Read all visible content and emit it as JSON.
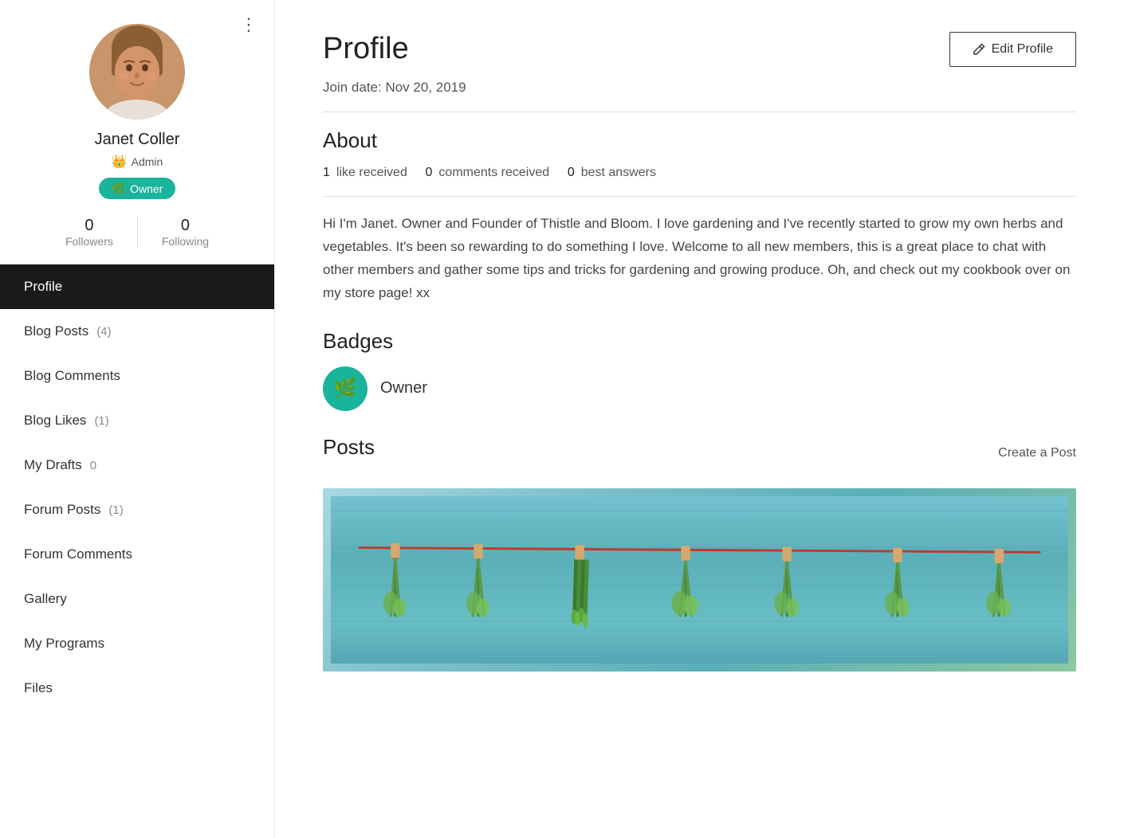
{
  "sidebar": {
    "more_menu_label": "⋮",
    "user": {
      "name": "Janet Coller",
      "role": "Admin",
      "badge": "Owner",
      "followers": 0,
      "following": 0,
      "followers_label": "Followers",
      "following_label": "Following"
    },
    "nav_items": [
      {
        "id": "profile",
        "label": "Profile",
        "badge": null,
        "active": true
      },
      {
        "id": "blog-posts",
        "label": "Blog Posts",
        "badge": "(4)",
        "active": false
      },
      {
        "id": "blog-comments",
        "label": "Blog Comments",
        "badge": null,
        "active": false
      },
      {
        "id": "blog-likes",
        "label": "Blog Likes",
        "badge": "(1)",
        "active": false
      },
      {
        "id": "my-drafts",
        "label": "My Drafts",
        "badge": "0",
        "active": false
      },
      {
        "id": "forum-posts",
        "label": "Forum Posts",
        "badge": "(1)",
        "active": false
      },
      {
        "id": "forum-comments",
        "label": "Forum Comments",
        "badge": null,
        "active": false
      },
      {
        "id": "gallery",
        "label": "Gallery",
        "badge": null,
        "active": false
      },
      {
        "id": "my-programs",
        "label": "My Programs",
        "badge": null,
        "active": false
      },
      {
        "id": "files",
        "label": "Files",
        "badge": null,
        "active": false
      }
    ]
  },
  "main": {
    "page_title": "Profile",
    "edit_profile_label": "Edit Profile",
    "join_date": "Join date: Nov 20, 2019",
    "about_section": {
      "title": "About",
      "likes_received_count": "1",
      "likes_received_label": "like received",
      "comments_received_count": "0",
      "comments_received_label": "comments received",
      "best_answers_count": "0",
      "best_answers_label": "best answers"
    },
    "bio": "Hi I'm Janet. Owner and Founder of Thistle and Bloom. I love gardening and I've recently started to grow my own herbs and vegetables. It's been so rewarding to do something I love. Welcome to all new members, this is a great place to chat with other members and gather some tips and tricks for gardening and growing produce. Oh, and check out my cookbook over on my store page! xx",
    "badges_section": {
      "title": "Badges",
      "badges": [
        {
          "name": "Owner"
        }
      ]
    },
    "posts_section": {
      "title": "Posts",
      "create_post_label": "Create a Post"
    }
  },
  "colors": {
    "teal": "#1ab39b",
    "active_nav": "#1a1a1a"
  }
}
